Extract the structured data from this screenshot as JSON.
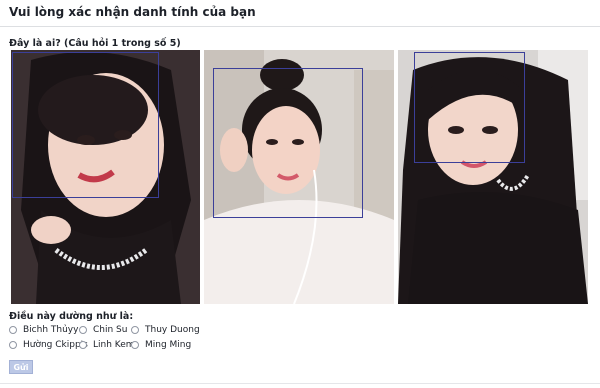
{
  "header": {
    "title": "Vui lòng xác nhận danh tính của bạn"
  },
  "question": {
    "label": "Đây là ai? (Câu hỏi 1 trong số 5)"
  },
  "photos": [
    {
      "name": "photo-1"
    },
    {
      "name": "photo-2"
    },
    {
      "name": "photo-3"
    }
  ],
  "answers": {
    "label": "Điều này dường như là:",
    "options": [
      "Bichh Thủyy",
      "Chin Su",
      "Thuy Duong",
      "Hường Ckipp's",
      "Linh Kem",
      "Ming Ming"
    ]
  },
  "submit": {
    "label": "Gửi"
  },
  "colors": {
    "face_box": "#3b3f99",
    "button": "#bcc8e6"
  }
}
